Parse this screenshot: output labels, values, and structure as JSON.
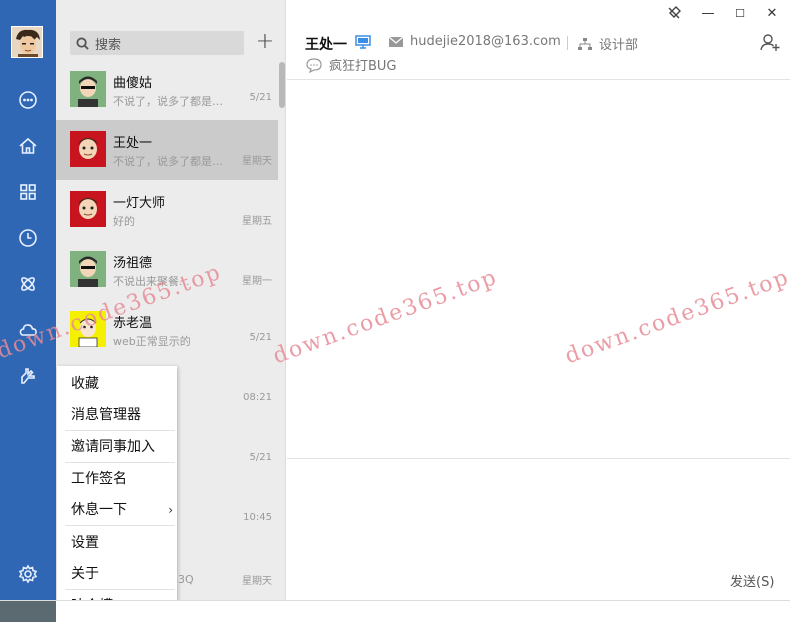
{
  "window": {
    "controls": [
      "—",
      "☐",
      "✕"
    ]
  },
  "search": {
    "placeholder": "搜索"
  },
  "contacts": [
    {
      "name": "曲傻姑",
      "message": "不说了，说多了都是泪...",
      "time": "5/21",
      "avatar_color": "#7fb27f"
    },
    {
      "name": "王处一",
      "message": "不说了，说多了都是泪...",
      "time": "星期天",
      "avatar_color": "#c8141e"
    },
    {
      "name": "一灯大师",
      "message": "好的",
      "time": "星期五",
      "avatar_color": "#c8141e"
    },
    {
      "name": "汤祖德",
      "message": "不说出来聚餐...",
      "time": "星期一",
      "avatar_color": "#7fb27f"
    },
    {
      "name": "赤老温",
      "message": "web正常显示的",
      "time": "5/21",
      "avatar_color": "#f5f000"
    },
    {
      "name": "",
      "message": "",
      "time": "08:21",
      "avatar_color": ""
    },
    {
      "name": "",
      "message": "",
      "time": "5/21",
      "avatar_color": ""
    },
    {
      "name": "",
      "message": "",
      "time": "10:45",
      "avatar_color": ""
    },
    {
      "name": "",
      "message": "3Q",
      "time": "星期天",
      "avatar_color": ""
    }
  ],
  "menu": {
    "items": [
      "收藏",
      "消息管理器",
      "邀请同事加入",
      "工作签名",
      "休息一下",
      "设置",
      "关于",
      "吐个槽"
    ],
    "submenu_arrow": "›"
  },
  "chat": {
    "name": "王处一",
    "email": "hudejie2018@163.com",
    "department": "设计部",
    "signature": "疯狂打BUG",
    "send_label": "发送(S)"
  },
  "watermark": "down.code365.top",
  "colors": {
    "rail": "#2f67b4",
    "list_bg": "#ececec",
    "selected": "#cbcbcb",
    "watermark": "#e68c96"
  }
}
